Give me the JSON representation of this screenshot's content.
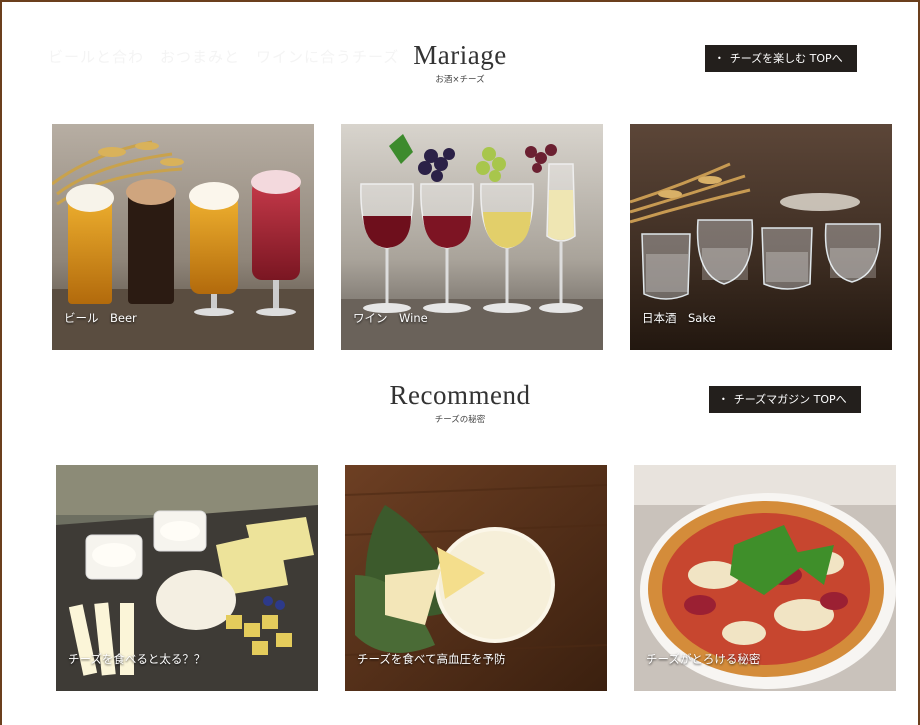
{
  "nav_ghost": "ビールと合わ　おつまみと　ワインに合うチーズ",
  "mariage": {
    "title": "Mariage",
    "subtitle": "お酒×チーズ",
    "button": "チーズを楽しむ TOPへ",
    "cards": [
      {
        "label": "ビール　Beer"
      },
      {
        "label": "ワイン　Wine"
      },
      {
        "label": "日本酒　Sake"
      }
    ]
  },
  "recommend": {
    "title": "Recommend",
    "subtitle": "チーズの秘密",
    "button": "チーズマガジン TOPへ",
    "cards": [
      {
        "label": "チーズを食べると太る？？"
      },
      {
        "label": "チーズを食べて高血圧を予防"
      },
      {
        "label": "チーズがとろける秘密"
      }
    ]
  },
  "colors": {
    "accent_border": "#6b3f1d",
    "button_bg": "#231f1c"
  }
}
